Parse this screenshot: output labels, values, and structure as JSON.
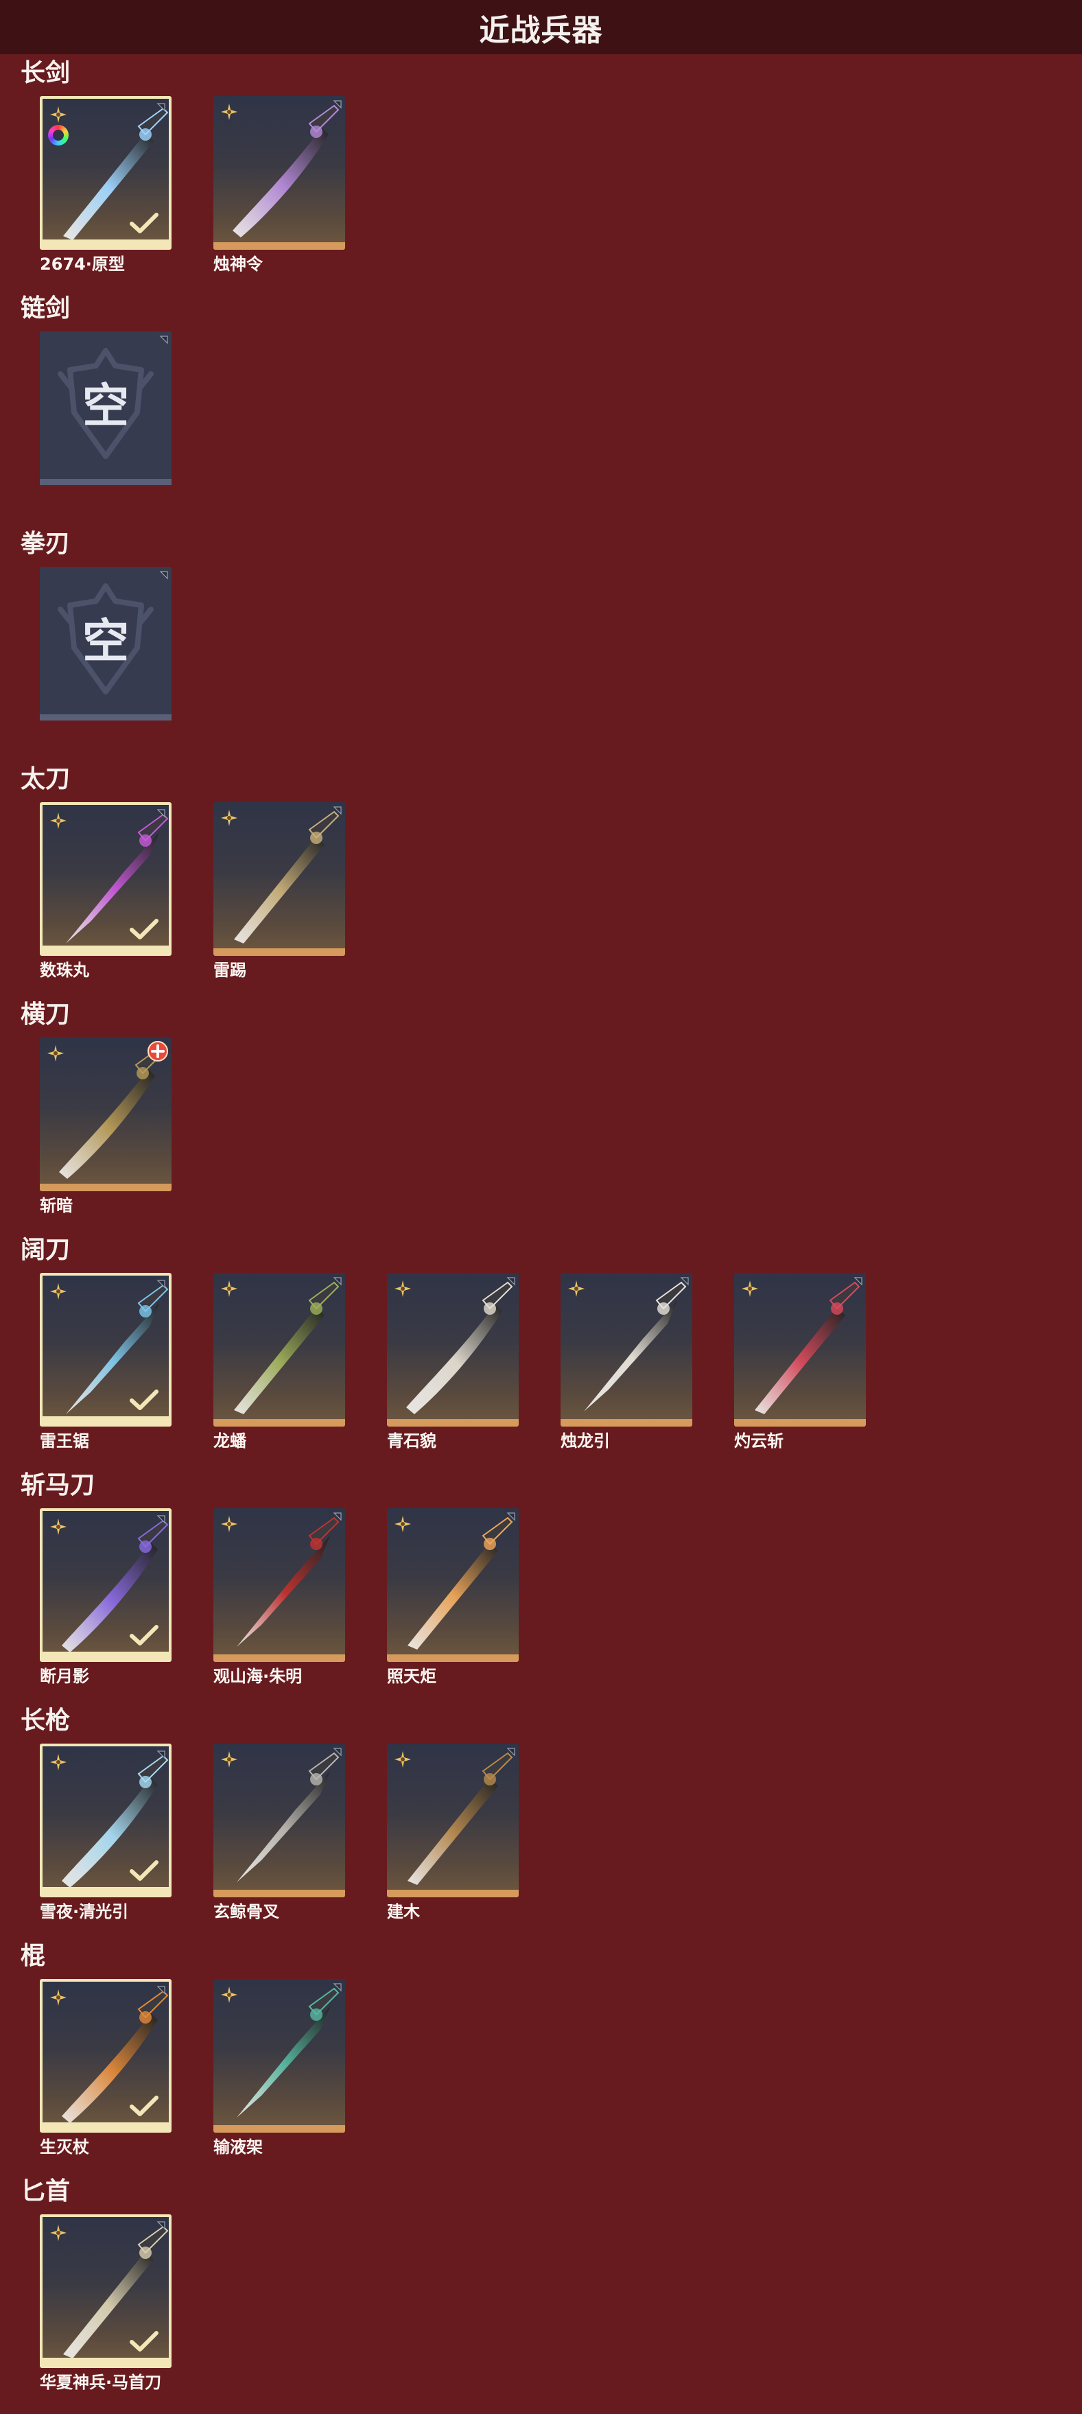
{
  "page_title": "近战兵器",
  "colors": {
    "background": "#681b1f",
    "header": "#3e1214",
    "equipped_border": "#f3e7b8",
    "card_bar": "#d59a5c"
  },
  "categories": [
    {
      "title": "长剑",
      "items": [
        {
          "name": "2674·原型",
          "equipped": true,
          "rgb": true,
          "color": "#9fd6ff"
        },
        {
          "name": "烛神令",
          "equipped": false,
          "color": "#b58ad8"
        }
      ]
    },
    {
      "title": "链剑",
      "empty": true,
      "empty_label": "空",
      "items": []
    },
    {
      "title": "拳刃",
      "empty": true,
      "empty_label": "空",
      "items": []
    },
    {
      "title": "太刀",
      "items": [
        {
          "name": "数珠丸",
          "equipped": true,
          "color": "#c75ad9"
        },
        {
          "name": "雷踢",
          "equipped": false,
          "color": "#c9b07a"
        }
      ]
    },
    {
      "title": "横刀",
      "items": [
        {
          "name": "斩暗",
          "equipped": false,
          "plus_badge": true,
          "color": "#b89b58"
        }
      ]
    },
    {
      "title": "阔刀",
      "items": [
        {
          "name": "雷王锯",
          "equipped": true,
          "color": "#7fc7ea"
        },
        {
          "name": "龙蟠",
          "equipped": false,
          "color": "#9fb05a"
        },
        {
          "name": "青石貌",
          "equipped": false,
          "color": "#e3ddd0"
        },
        {
          "name": "烛龙引",
          "equipped": false,
          "color": "#e8e4da"
        },
        {
          "name": "灼云斩",
          "equipped": false,
          "color": "#d94a5c"
        }
      ]
    },
    {
      "title": "斩马刀",
      "items": [
        {
          "name": "断月影",
          "equipped": true,
          "color": "#8a6ae0"
        },
        {
          "name": "观山海·朱明",
          "equipped": false,
          "color": "#c2322f"
        },
        {
          "name": "照天炬",
          "equipped": false,
          "color": "#f0a85a"
        }
      ]
    },
    {
      "title": "长枪",
      "items": [
        {
          "name": "雪夜·清光引",
          "equipped": true,
          "color": "#a8dcf4"
        },
        {
          "name": "玄鲸骨叉",
          "equipped": false,
          "color": "#b9b6ae"
        },
        {
          "name": "建木",
          "equipped": false,
          "color": "#b88a4e"
        }
      ]
    },
    {
      "title": "棍",
      "items": [
        {
          "name": "生灭杖",
          "equipped": true,
          "color": "#e28a3a"
        },
        {
          "name": "输液架",
          "equipped": false,
          "color": "#56b8a0"
        }
      ]
    },
    {
      "title": "匕首",
      "items": [
        {
          "name": "华夏神兵·马首刀",
          "equipped": true,
          "color": "#d9d0b0"
        }
      ]
    }
  ]
}
